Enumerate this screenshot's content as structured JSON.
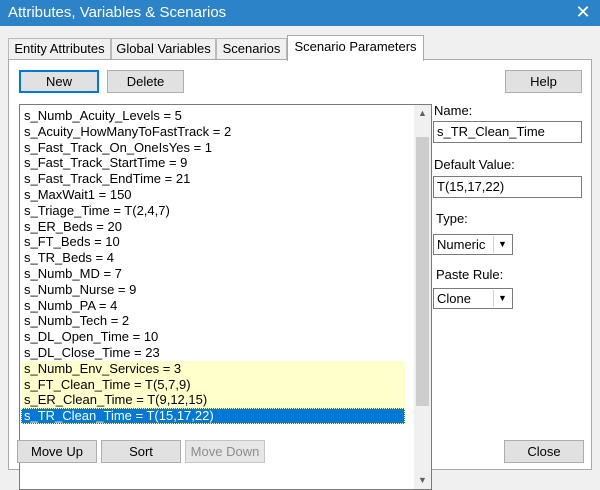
{
  "window": {
    "title": "Attributes, Variables & Scenarios",
    "close_glyph": "✕"
  },
  "tabs": [
    {
      "label": "Entity Attributes",
      "active": false
    },
    {
      "label": "Global Variables",
      "active": false
    },
    {
      "label": "Scenarios",
      "active": false
    },
    {
      "label": "Scenario Parameters",
      "active": true
    }
  ],
  "toolbar": {
    "new_label": "New",
    "delete_label": "Delete",
    "help_label": "Help"
  },
  "parameters": [
    "s_Numb_Acuity_Levels = 5",
    "s_Acuity_HowManyToFastTrack = 2",
    "s_Fast_Track_On_OneIsYes = 1",
    "s_Fast_Track_StartTime = 9",
    "s_Fast_Track_EndTime = 21",
    "s_MaxWait1 = 150",
    "s_Triage_Time = T(2,4,7)",
    "s_ER_Beds = 20",
    "s_FT_Beds = 10",
    "s_TR_Beds = 4",
    "s_Numb_MD = 7",
    "s_Numb_Nurse = 9",
    "s_Numb_PA = 4",
    "s_Numb_Tech = 2",
    "s_DL_Open_Time = 10",
    "s_DL_Close_Time = 23",
    "s_Numb_Env_Services = 3",
    "s_FT_Clean_Time = T(5,7,9)",
    "s_ER_Clean_Time = T(9,12,15)",
    "s_TR_Clean_Time = T(15,17,22)"
  ],
  "highlighted_indices": [
    16,
    17,
    18
  ],
  "selected_index": 19,
  "details": {
    "name_label": "Name:",
    "name_value": "s_TR_Clean_Time",
    "default_label": "Default Value:",
    "default_value": "T(15,17,22)",
    "type_label": "Type:",
    "type_value": "Numeric",
    "paste_label": "Paste Rule:",
    "paste_value": "Clone"
  },
  "footer": {
    "move_up_label": "Move Up",
    "sort_label": "Sort",
    "move_down_label": "Move Down",
    "close_label": "Close"
  },
  "colors": {
    "titlebar": "#2d83c8",
    "selection": "#0078d7",
    "highlight": "#ffffcc"
  }
}
